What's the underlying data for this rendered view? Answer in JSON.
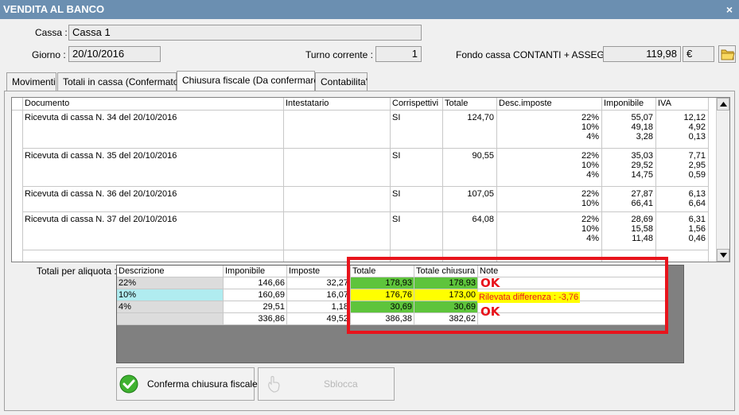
{
  "window": {
    "title": "VENDITA AL BANCO",
    "close_symbol": "×"
  },
  "header": {
    "cassa_label": "Cassa :",
    "cassa_value": "Cassa 1",
    "giorno_label": "Giorno :",
    "giorno_value": "20/10/2016",
    "turno_label": "Turno corrente :",
    "turno_value": "1",
    "fondo_label": "Fondo cassa CONTANTI + ASSEGNI :",
    "fondo_value": "119,98",
    "currency": "€"
  },
  "tabs": [
    {
      "label": "Movimenti"
    },
    {
      "label": "Totali in cassa (Confermato)"
    },
    {
      "label": "Chiusura fiscale (Da confermare)"
    },
    {
      "label": "Contabilita'"
    }
  ],
  "grid": {
    "columns": [
      "Documento",
      "Intestatario",
      "Corrispettivi",
      "Totale",
      "Desc.imposte",
      "Imponibile",
      "IVA"
    ],
    "rows": [
      {
        "documento": "Ricevuta di cassa N. 34 del 20/10/2016",
        "corrispettivi": "SI",
        "totale": "124,70",
        "aliquote": [
          "22%",
          "10%",
          "4%"
        ],
        "imponibili": [
          "55,07",
          "49,18",
          "3,28"
        ],
        "iva": [
          "12,12",
          "4,92",
          "0,13"
        ]
      },
      {
        "documento": "Ricevuta di cassa N. 35 del 20/10/2016",
        "corrispettivi": "SI",
        "totale": "90,55",
        "aliquote": [
          "22%",
          "10%",
          "4%"
        ],
        "imponibili": [
          "35,03",
          "29,52",
          "14,75"
        ],
        "iva": [
          "7,71",
          "2,95",
          "0,59"
        ]
      },
      {
        "documento": "Ricevuta di cassa N. 36 del 20/10/2016",
        "corrispettivi": "SI",
        "totale": "107,05",
        "aliquote": [
          "22%",
          "10%"
        ],
        "imponibili": [
          "27,87",
          "66,41"
        ],
        "iva": [
          "6,13",
          "6,64"
        ]
      },
      {
        "documento": "Ricevuta di cassa N. 37 del 20/10/2016",
        "corrispettivi": "SI",
        "totale": "64,08",
        "aliquote": [
          "22%",
          "10%",
          "4%"
        ],
        "imponibili": [
          "28,69",
          "15,58",
          "11,48"
        ],
        "iva": [
          "6,31",
          "1,56",
          "0,46"
        ]
      }
    ]
  },
  "totals": {
    "label": "Totali per aliquota :",
    "columns": [
      "Descrizione",
      "Imponibile",
      "Imposte",
      "Totale",
      "Totale chiusura",
      "Note"
    ],
    "rows": [
      {
        "descrizione": "22%",
        "imponibile": "146,66",
        "imposte": "32,27",
        "totale": "178,93",
        "totale_chiusura": "178,93",
        "note": "OK"
      },
      {
        "descrizione": "10%",
        "imponibile": "160,69",
        "imposte": "16,07",
        "totale": "176,76",
        "totale_chiusura": "173,00",
        "note": "Rilevata differenza : -3,76"
      },
      {
        "descrizione": "4%",
        "imponibile": "29,51",
        "imposte": "1,18",
        "totale": "30,69",
        "totale_chiusura": "30,69",
        "note": "OK"
      },
      {
        "descrizione": "",
        "imponibile": "336,86",
        "imposte": "49,52",
        "totale": "386,38",
        "totale_chiusura": "382,62",
        "note": ""
      }
    ]
  },
  "buttons": {
    "confirm_label": "Conferma chiusura fiscale",
    "unlock_label": "Sblocca"
  },
  "colors": {
    "ok_green": "#5ec43c",
    "warn_yellow": "#ffff00",
    "alert_red": "#e8141c",
    "title_bar": "#6b8fb1"
  }
}
